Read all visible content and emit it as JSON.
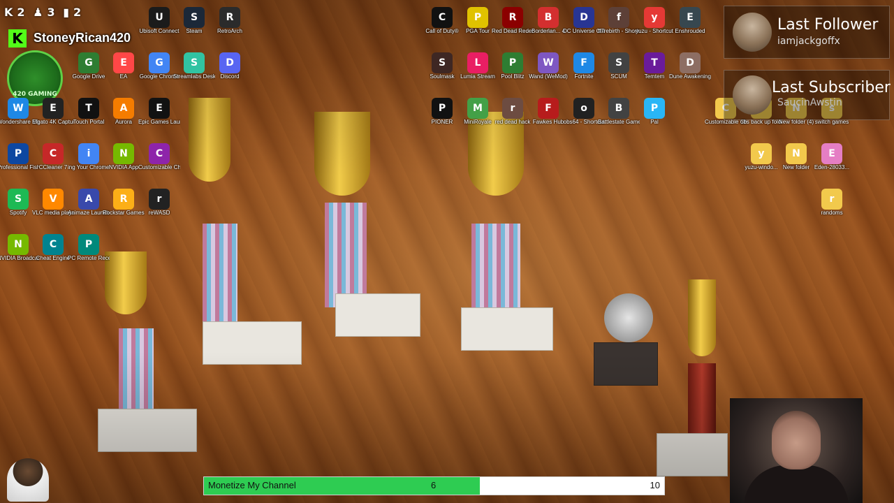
{
  "header": {
    "stats": [
      {
        "icon": "kick-viewers-icon",
        "value": "2"
      },
      {
        "icon": "followers-icon",
        "value": "3"
      },
      {
        "icon": "chart-icon",
        "value": "2"
      }
    ],
    "channel_logo": "K",
    "channel_name": "StoneyRican420",
    "badge_text": "420 GAMING"
  },
  "desktop_icons": [
    {
      "label": "Ubisoft Connect",
      "icon": "ubisoft-icon",
      "color": "#1b1b1b"
    },
    {
      "label": "Steam",
      "icon": "steam-icon",
      "color": "#1b2838"
    },
    {
      "label": "RetroArch",
      "icon": "retroarch-icon",
      "color": "#2b2b2b"
    },
    {
      "label": "Google Drive",
      "icon": "google-drive-icon",
      "color": "#2e7d32"
    },
    {
      "label": "EA",
      "icon": "ea-icon",
      "color": "#ff4747"
    },
    {
      "label": "Google Chrome",
      "icon": "chrome-icon",
      "color": "#4285f4"
    },
    {
      "label": "Streamlabs Desktop",
      "icon": "streamlabs-icon",
      "color": "#31c3a2"
    },
    {
      "label": "Discord",
      "icon": "discord-icon",
      "color": "#5865f2"
    },
    {
      "label": "Wondershare MirrorGo",
      "icon": "mirrorgo-icon",
      "color": "#1e88e5"
    },
    {
      "label": "Elgato 4K Captur...",
      "icon": "elgato-icon",
      "color": "#222222"
    },
    {
      "label": "Touch Portal",
      "icon": "touch-portal-icon",
      "color": "#111111"
    },
    {
      "label": "Aurora",
      "icon": "aurora-icon",
      "color": "#f57c00"
    },
    {
      "label": "Epic Games Launcher",
      "icon": "epic-games-icon",
      "color": "#121212"
    },
    {
      "label": "Professional Fishing 2 (1)",
      "icon": "fishing-icon",
      "color": "#0d47a1"
    },
    {
      "label": "CCleaner 7",
      "icon": "ccleaner-icon",
      "color": "#c62828"
    },
    {
      "label": "ing Your Chrome...",
      "icon": "chrome-icon",
      "color": "#4285f4"
    },
    {
      "label": "NVIDIA App",
      "icon": "nvidia-icon",
      "color": "#76b900"
    },
    {
      "label": "Customizable Cheat Arrows",
      "icon": "winrar-icon",
      "color": "#8e24aa"
    },
    {
      "label": "Spotify",
      "icon": "spotify-icon",
      "color": "#1db954"
    },
    {
      "label": "VLC media player",
      "icon": "vlc-icon",
      "color": "#ff8800"
    },
    {
      "label": "Animaze Launcher",
      "icon": "animaze-icon",
      "color": "#3949ab"
    },
    {
      "label": "Rockstar Games...",
      "icon": "rockstar-icon",
      "color": "#fcaf17"
    },
    {
      "label": "reWASD",
      "icon": "rewasd-icon",
      "color": "#222222"
    },
    {
      "label": "NVIDIA Broadcast",
      "icon": "nvidia-broadcast-icon",
      "color": "#76b900"
    },
    {
      "label": "Cheat Engine",
      "icon": "cheat-engine-icon",
      "color": "#00838f"
    },
    {
      "label": "PC Remote Receiver",
      "icon": "pc-remote-icon",
      "color": "#00897b"
    },
    {
      "label": "Call of Duty®",
      "icon": "call-of-duty-icon",
      "color": "#111111"
    },
    {
      "label": "PGA Tour",
      "icon": "pga-tour-icon",
      "color": "#e0c200"
    },
    {
      "label": "Red Dead Redempti...",
      "icon": "red-dead-icon",
      "color": "#8b0000"
    },
    {
      "label": "Borderlan... 4",
      "icon": "borderlands-icon",
      "color": "#d32f2f"
    },
    {
      "label": "DC Universe Online",
      "icon": "dc-universe-icon",
      "color": "#283593"
    },
    {
      "label": "ff7rebirth - Shortcut",
      "icon": "ff7-icon",
      "color": "#5d4037"
    },
    {
      "label": "yuzu - Shortcut",
      "icon": "yuzu-icon",
      "color": "#e53935"
    },
    {
      "label": "Enshrouded",
      "icon": "enshrouded-icon",
      "color": "#37474f"
    },
    {
      "label": "Soulmask",
      "icon": "soulmask-icon",
      "color": "#3e2723"
    },
    {
      "label": "Lumia Stream",
      "icon": "lumia-stream-icon",
      "color": "#e91e63"
    },
    {
      "label": "Pool Blitz",
      "icon": "pool-blitz-icon",
      "color": "#2e7d32"
    },
    {
      "label": "Wand (WeMod)",
      "icon": "wand-icon",
      "color": "#7e57c2"
    },
    {
      "label": "Fortnite",
      "icon": "fortnite-icon",
      "color": "#1e88e5"
    },
    {
      "label": "SCUM",
      "icon": "scum-icon",
      "color": "#424242"
    },
    {
      "label": "Temtem",
      "icon": "temtem-icon",
      "color": "#6a1b9a"
    },
    {
      "label": "Dune Awakening",
      "icon": "dune-icon",
      "color": "#8d6e63"
    },
    {
      "label": "PIONER",
      "icon": "pioner-icon",
      "color": "#111111"
    },
    {
      "label": "MiniRoyale",
      "icon": "miniroyale-icon",
      "color": "#43a047"
    },
    {
      "label": "red dead hack",
      "icon": "red-dead-hack-icon",
      "color": "#6d4c41"
    },
    {
      "label": "Fawkes Hub",
      "icon": "fawkes-hub-icon",
      "color": "#b71c1c"
    },
    {
      "label": "obs64 - Shortcut",
      "icon": "obs-icon",
      "color": "#212121"
    },
    {
      "label": "Battlestate Games L...",
      "icon": "battlestate-icon",
      "color": "#424242"
    },
    {
      "label": "Pal",
      "icon": "pal-icon",
      "color": "#29b6f6"
    },
    {
      "label": "Customizable Cheat Arrows",
      "icon": "folder-icon",
      "color": "#f2c94c"
    },
    {
      "label": "obs back up folder",
      "icon": "folder-icon",
      "color": "#f2c94c"
    },
    {
      "label": "New folder (4)",
      "icon": "folder-icon",
      "color": "#f2c94c"
    },
    {
      "label": "switch games",
      "icon": "folder-icon",
      "color": "#f2c94c"
    },
    {
      "label": "yuzu-windo...",
      "icon": "folder-icon",
      "color": "#f2c94c"
    },
    {
      "label": "New folder",
      "icon": "folder-icon",
      "color": "#f2c94c"
    },
    {
      "label": "Eden-28033...",
      "icon": "folder-icon",
      "color": "#e57ec4"
    },
    {
      "label": "randoms",
      "icon": "folder-icon",
      "color": "#f2c94c"
    }
  ],
  "alerts": {
    "follower_title": "Last Follower",
    "follower_name": "iamjackgoffx",
    "subscriber_title": "Last Subscriber",
    "subscriber_name": "SaucinAwstin"
  },
  "goal": {
    "label": "Monetize My Channel",
    "current": "6",
    "target": "10",
    "fraction": 0.6,
    "fill_color": "#2ecc52"
  }
}
